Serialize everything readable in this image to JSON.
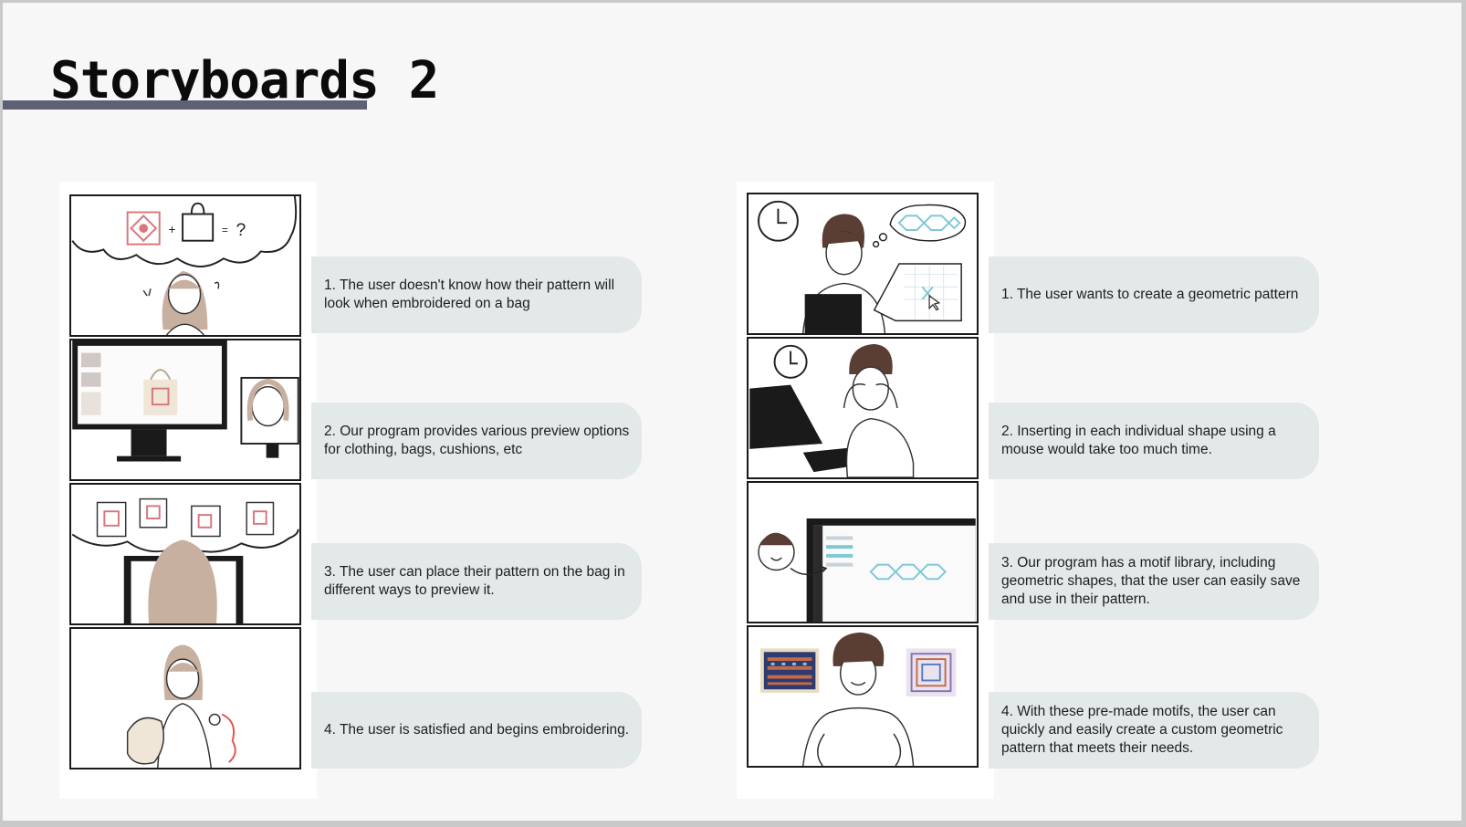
{
  "slide": {
    "title": "Storyboards 2"
  },
  "left_storyboard": {
    "captions": [
      "1. The user doesn't know how their pattern will look when embroidered on a bag",
      "2. Our program provides various preview options for clothing, bags, cushions, etc",
      "3. The user can place their pattern on the bag in different ways to preview it.",
      "4. The user is satisfied and begins embroidering."
    ],
    "panel1_symbols": {
      "plus": "+",
      "equals": "=",
      "question": "?"
    }
  },
  "right_storyboard": {
    "captions": [
      "1. The user wants to create a geometric pattern",
      "2. Inserting in each individual shape using a mouse would take too much time.",
      "3. Our program has a motif library, including geometric shapes, that the user can easily save and use in their pattern.",
      "4. With these pre-made motifs, the user can quickly and easily create a custom geometric pattern that meets their needs."
    ]
  },
  "colors": {
    "title_bar": "#5d6173",
    "caption_bg": "#e3e8e8",
    "pattern_red": "#d9767a",
    "pattern_cyan": "#7fc8d6",
    "hair_brown": "#5a3d33",
    "hair_light": "#c8b0a0"
  }
}
